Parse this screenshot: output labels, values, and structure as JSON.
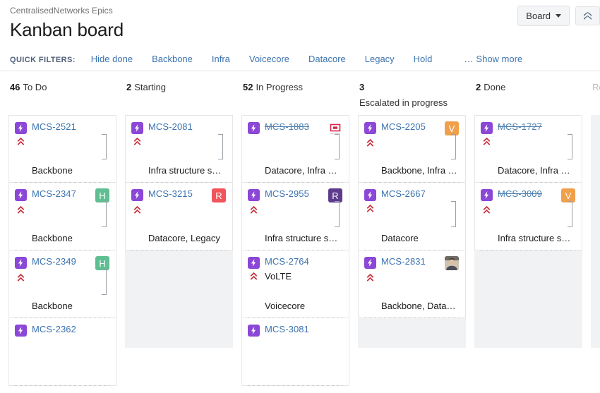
{
  "header": {
    "breadcrumb": "CentralisedNetworks Epics",
    "title": "Kanban board",
    "board_button": "Board",
    "collapse_button_name": "collapse"
  },
  "quick_filters": {
    "label": "QUICK FILTERS:",
    "items": [
      "Hide done",
      "Backbone",
      "Infra",
      "Voicecore",
      "Datacore",
      "Legacy",
      "Hold"
    ],
    "show_more": "Show more",
    "show_more_dots": "…"
  },
  "columns": [
    {
      "count": "46",
      "name": "To Do",
      "sub": "",
      "muted": false,
      "cards": [
        {
          "key": "MCS-2521",
          "done": false,
          "summary": "",
          "labels": "Backbone",
          "priority": "highest",
          "avatar": null,
          "bracket": true
        },
        {
          "key": "MCS-2347",
          "done": false,
          "summary": "",
          "labels": "Backbone",
          "priority": "highest",
          "avatar": {
            "type": "letter",
            "text": "H",
            "color": "green"
          },
          "bracket": true
        },
        {
          "key": "MCS-2349",
          "done": false,
          "summary": "",
          "labels": "Backbone",
          "priority": "highest",
          "avatar": {
            "type": "letter",
            "text": "H",
            "color": "green"
          },
          "bracket": true
        },
        {
          "key": "MCS-2362",
          "done": false,
          "summary": "",
          "labels": "",
          "priority": "none",
          "avatar": null,
          "bracket": false
        }
      ]
    },
    {
      "count": "2",
      "name": "Starting",
      "sub": "",
      "muted": false,
      "cards": [
        {
          "key": "MCS-2081",
          "done": false,
          "summary": "",
          "labels": "Infra structure s…",
          "priority": "highest",
          "avatar": null,
          "bracket": true
        },
        {
          "key": "MCS-3215",
          "done": false,
          "summary": "",
          "labels": "Datacore, Legacy",
          "priority": "highest",
          "avatar": {
            "type": "letter",
            "text": "R",
            "color": "red"
          },
          "bracket": false
        }
      ]
    },
    {
      "count": "52",
      "name": "In Progress",
      "sub": "",
      "muted": false,
      "cards": [
        {
          "key": "MCS-1883",
          "done": true,
          "summary": "",
          "labels": "Datacore, Infra …",
          "priority": "none",
          "avatar": {
            "type": "logo",
            "text": "openstack",
            "color": "logo"
          },
          "bracket": true
        },
        {
          "key": "MCS-2955",
          "done": false,
          "summary": "",
          "labels": "Infra structure s…",
          "priority": "highest",
          "avatar": {
            "type": "letter",
            "text": "R",
            "color": "purple"
          },
          "bracket": true
        },
        {
          "key": "MCS-2764",
          "done": false,
          "summary": "VoLTE",
          "labels": "Voicecore",
          "priority": "highest",
          "avatar": null,
          "bracket": false
        },
        {
          "key": "MCS-3081",
          "done": false,
          "summary": "",
          "labels": "",
          "priority": "none",
          "avatar": null,
          "bracket": false
        }
      ]
    },
    {
      "count": "3",
      "name": "",
      "sub": "Escalated in progress",
      "muted": false,
      "cards": [
        {
          "key": "MCS-2205",
          "done": false,
          "summary": "",
          "labels": "Backbone, Infra …",
          "priority": "highest",
          "avatar": {
            "type": "letter",
            "text": "V",
            "color": "orange"
          },
          "bracket": true
        },
        {
          "key": "MCS-2667",
          "done": false,
          "summary": "",
          "labels": "Datacore",
          "priority": "highest",
          "avatar": null,
          "bracket": true
        },
        {
          "key": "MCS-2831",
          "done": false,
          "summary": "",
          "labels": "Backbone, Data…",
          "priority": "highest",
          "avatar": {
            "type": "photo",
            "text": "",
            "color": "photo"
          },
          "bracket": false
        }
      ]
    },
    {
      "count": "2",
      "name": "Done",
      "sub": "",
      "muted": false,
      "cards": [
        {
          "key": "MCS-1727",
          "done": true,
          "summary": "",
          "labels": "Datacore, Infra …",
          "priority": "highest",
          "avatar": null,
          "bracket": true
        },
        {
          "key": "MCS-3009",
          "done": true,
          "summary": "",
          "labels": "Infra structure s…",
          "priority": "highest",
          "avatar": {
            "type": "letter",
            "text": "V",
            "color": "orange"
          },
          "bracket": true
        }
      ]
    },
    {
      "count": "",
      "name": "Release…",
      "sub": "",
      "muted": true,
      "cards": []
    }
  ],
  "colors": {
    "epic_purple": "#8b47d6",
    "link_blue": "#3b73af",
    "priority_red": "#c7303c",
    "column_bg": "#f1f2f4"
  }
}
